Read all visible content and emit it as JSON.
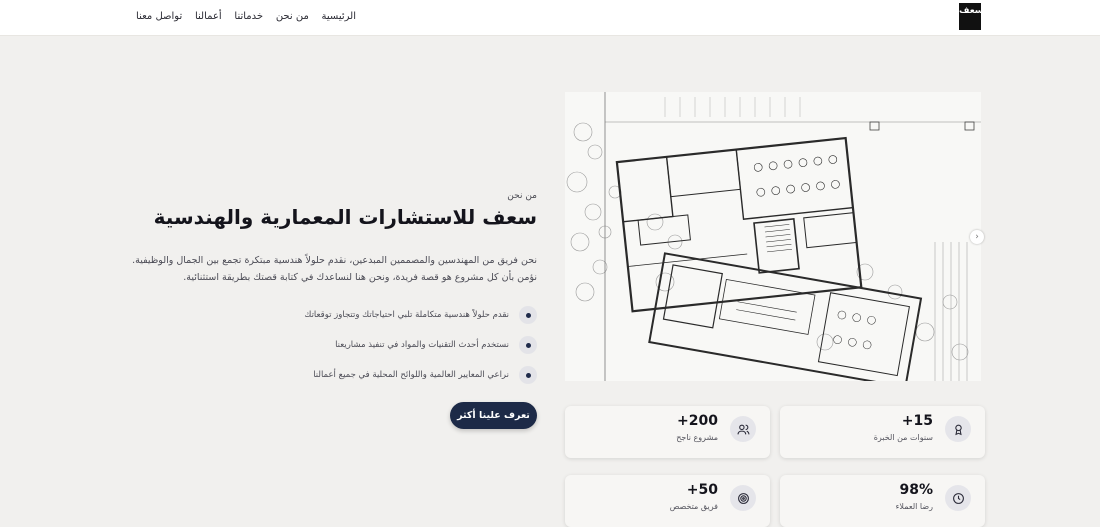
{
  "brand": {
    "logo_text": "سعف"
  },
  "nav": {
    "items": [
      {
        "label": "الرئيسية"
      },
      {
        "label": "من نحن"
      },
      {
        "label": "خدماتنا"
      },
      {
        "label": "أعمالنا"
      },
      {
        "label": "تواصل معنا"
      }
    ]
  },
  "hero": {
    "eyebrow": "من نحن",
    "title": "سعف للاستشارات المعمارية والهندسية",
    "description": "نحن فريق من المهندسين والمصممين المبدعين، نقدم حلولاً هندسية مبتكرة تجمع بين الجمال والوظيفية. نؤمن بأن كل مشروع هو قصة فريدة، ونحن هنا لنساعدك في كتابة قصتك بطريقة استثنائية.",
    "features": [
      {
        "text": "نقدم حلولاً هندسية متكاملة تلبي احتياجاتك وتتجاوز توقعاتك"
      },
      {
        "text": "نستخدم أحدث التقنيات والمواد في تنفيذ مشاريعنا"
      },
      {
        "text": "نراعي المعايير العالمية واللوائح المحلية في جميع أعمالنا"
      }
    ],
    "cta_label": "تعرف علينا أكثر"
  },
  "stats": [
    {
      "value": "+15",
      "label": "سنوات من الخبرة",
      "icon": "award-icon"
    },
    {
      "value": "+200",
      "label": "مشروع ناجح",
      "icon": "users-icon"
    },
    {
      "value": "98%",
      "label": "رضا العملاء",
      "icon": "clock-icon"
    },
    {
      "value": "+50",
      "label": "فريق متخصص",
      "icon": "target-icon"
    }
  ],
  "colors": {
    "primary": "#1d2a47",
    "background": "#f1f0ee",
    "card": "#f7f6f4"
  }
}
